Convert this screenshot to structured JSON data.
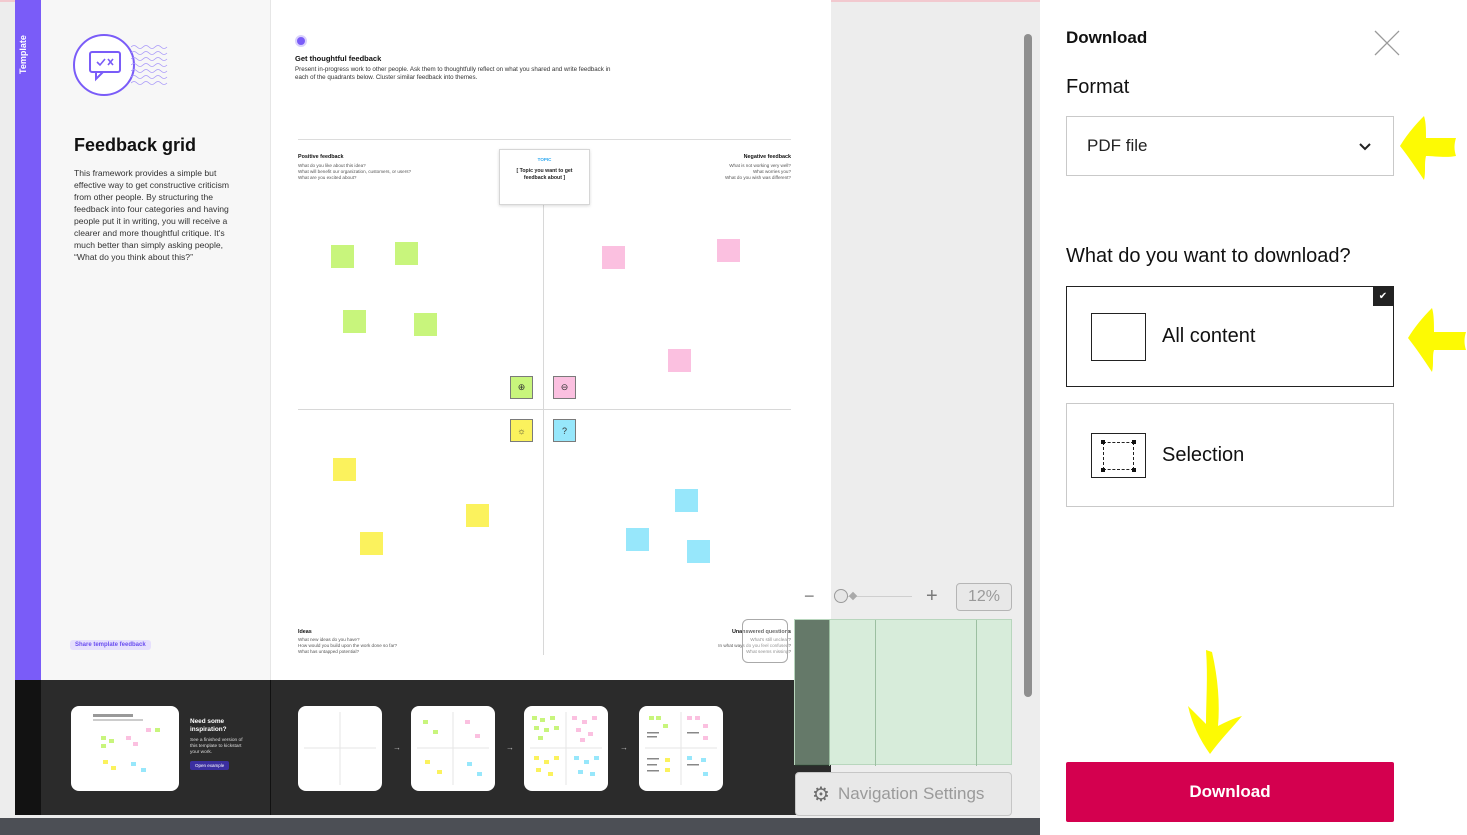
{
  "board": {
    "template_tag": "Template",
    "title": "Feedback grid",
    "description": "This framework provides a simple but effective way to get constructive criticism from other people. By structuring the feedback into four categories and having people put it in writing, you will receive a clearer and more thoughtful critique. It's much better than simply asking people, “What do you think about this?”",
    "share_button": "Share template feedback",
    "section_title": "Get thoughtful feedback",
    "section_desc": "Present in-progress work to other people. Ask them to thoughtfully reflect on what you shared and write feedback in each of the quadrants below. Cluster similar feedback into themes.",
    "topic_label": "TOPIC",
    "topic_text": "[ Topic you want to get feedback about ]",
    "quadrants": {
      "positive": {
        "title": "Positive feedback",
        "text": "What do you like about this idea?\nWhat will benefit our organization, customers, or users?\nWhat are you excited about?"
      },
      "negative": {
        "title": "Negative feedback",
        "text": "What is not working very well?\nWhat worries you?\nWhat do you wish was different?"
      },
      "ideas": {
        "title": "Ideas",
        "text": "What new ideas do you have?\nHow would you build upon the work done so far?\nWhat has untapped potential?"
      },
      "questions": {
        "title": "Unanswered questions",
        "text": "What's still unclear?\nIn what ways do you feel confused?\nWhat seems missing?"
      }
    },
    "inspiration": {
      "title": "Need some inspiration?",
      "desc": "See a finished version of this template to kickstart your work.",
      "button": "Open example"
    },
    "colors": {
      "green": "#c8f57c",
      "pink": "#fbc0e0",
      "yellow": "#fbf25d",
      "blue": "#97e7fb",
      "purple": "#7a5cf8"
    }
  },
  "navigation": {
    "zoom_minus": "−",
    "zoom_plus": "+",
    "zoom_level": "12%",
    "settings_label": "Navigation Settings"
  },
  "download_panel": {
    "title": "Download",
    "format_label": "Format",
    "format_value": "PDF file",
    "question": "What do you want to download?",
    "options": [
      {
        "label": "All content",
        "selected": true
      },
      {
        "label": "Selection",
        "selected": false
      }
    ],
    "download_button": "Download",
    "accent_color": "#d4004f"
  }
}
